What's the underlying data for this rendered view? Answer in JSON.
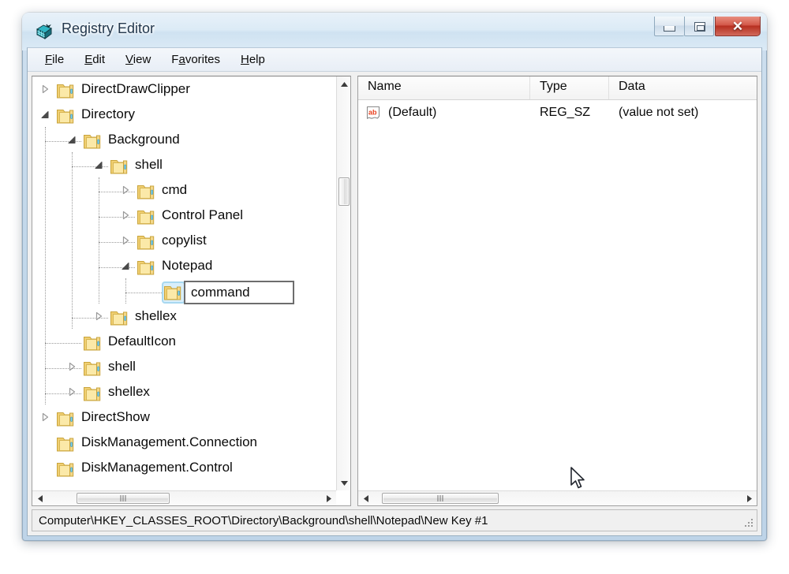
{
  "window": {
    "title": "Registry Editor",
    "app_icon": "registry-editor-icon",
    "controls": {
      "minimize_label": "–",
      "maximize_label": "❐",
      "close_label": "✕"
    }
  },
  "menu": {
    "items": [
      {
        "label": "File",
        "accel_index": 0
      },
      {
        "label": "Edit",
        "accel_index": 0
      },
      {
        "label": "View",
        "accel_index": 0
      },
      {
        "label": "Favorites",
        "accel_index": 1
      },
      {
        "label": "Help",
        "accel_index": 0
      }
    ]
  },
  "tree": {
    "rows": [
      {
        "label": "DirectDrawClipper",
        "depth": 0,
        "state": "collapsed"
      },
      {
        "label": "Directory",
        "depth": 0,
        "state": "expanded"
      },
      {
        "label": "Background",
        "depth": 1,
        "state": "expanded"
      },
      {
        "label": "shell",
        "depth": 2,
        "state": "expanded"
      },
      {
        "label": "cmd",
        "depth": 3,
        "state": "collapsed"
      },
      {
        "label": "Control Panel",
        "depth": 3,
        "state": "collapsed"
      },
      {
        "label": "copylist",
        "depth": 3,
        "state": "collapsed"
      },
      {
        "label": "Notepad",
        "depth": 3,
        "state": "expanded"
      },
      {
        "label": "command",
        "depth": 4,
        "state": "leaf",
        "editing": true
      },
      {
        "label": "shellex",
        "depth": 2,
        "state": "collapsed"
      },
      {
        "label": "DefaultIcon",
        "depth": 1,
        "state": "leaf"
      },
      {
        "label": "shell",
        "depth": 1,
        "state": "collapsed"
      },
      {
        "label": "shellex",
        "depth": 1,
        "state": "collapsed"
      },
      {
        "label": "DirectShow",
        "depth": 0,
        "state": "collapsed"
      },
      {
        "label": "DiskManagement.Connection",
        "depth": 0,
        "state": "leaf"
      },
      {
        "label": "DiskManagement.Control",
        "depth": 0,
        "state": "leaf",
        "clipped": true
      }
    ],
    "rename_value": "command"
  },
  "list": {
    "columns": [
      "Name",
      "Type",
      "Data"
    ],
    "rows": [
      {
        "icon": "string-value-icon",
        "name": "(Default)",
        "type": "REG_SZ",
        "data": "(value not set)"
      }
    ]
  },
  "status": {
    "path": "Computer\\HKEY_CLASSES_ROOT\\Directory\\Background\\shell\\Notepad\\New Key #1"
  },
  "colors": {
    "folder": "#f5d77a",
    "string_icon": "#e8401f",
    "selection_glow": "#a8d8f0",
    "close_button": "#c0392b"
  }
}
